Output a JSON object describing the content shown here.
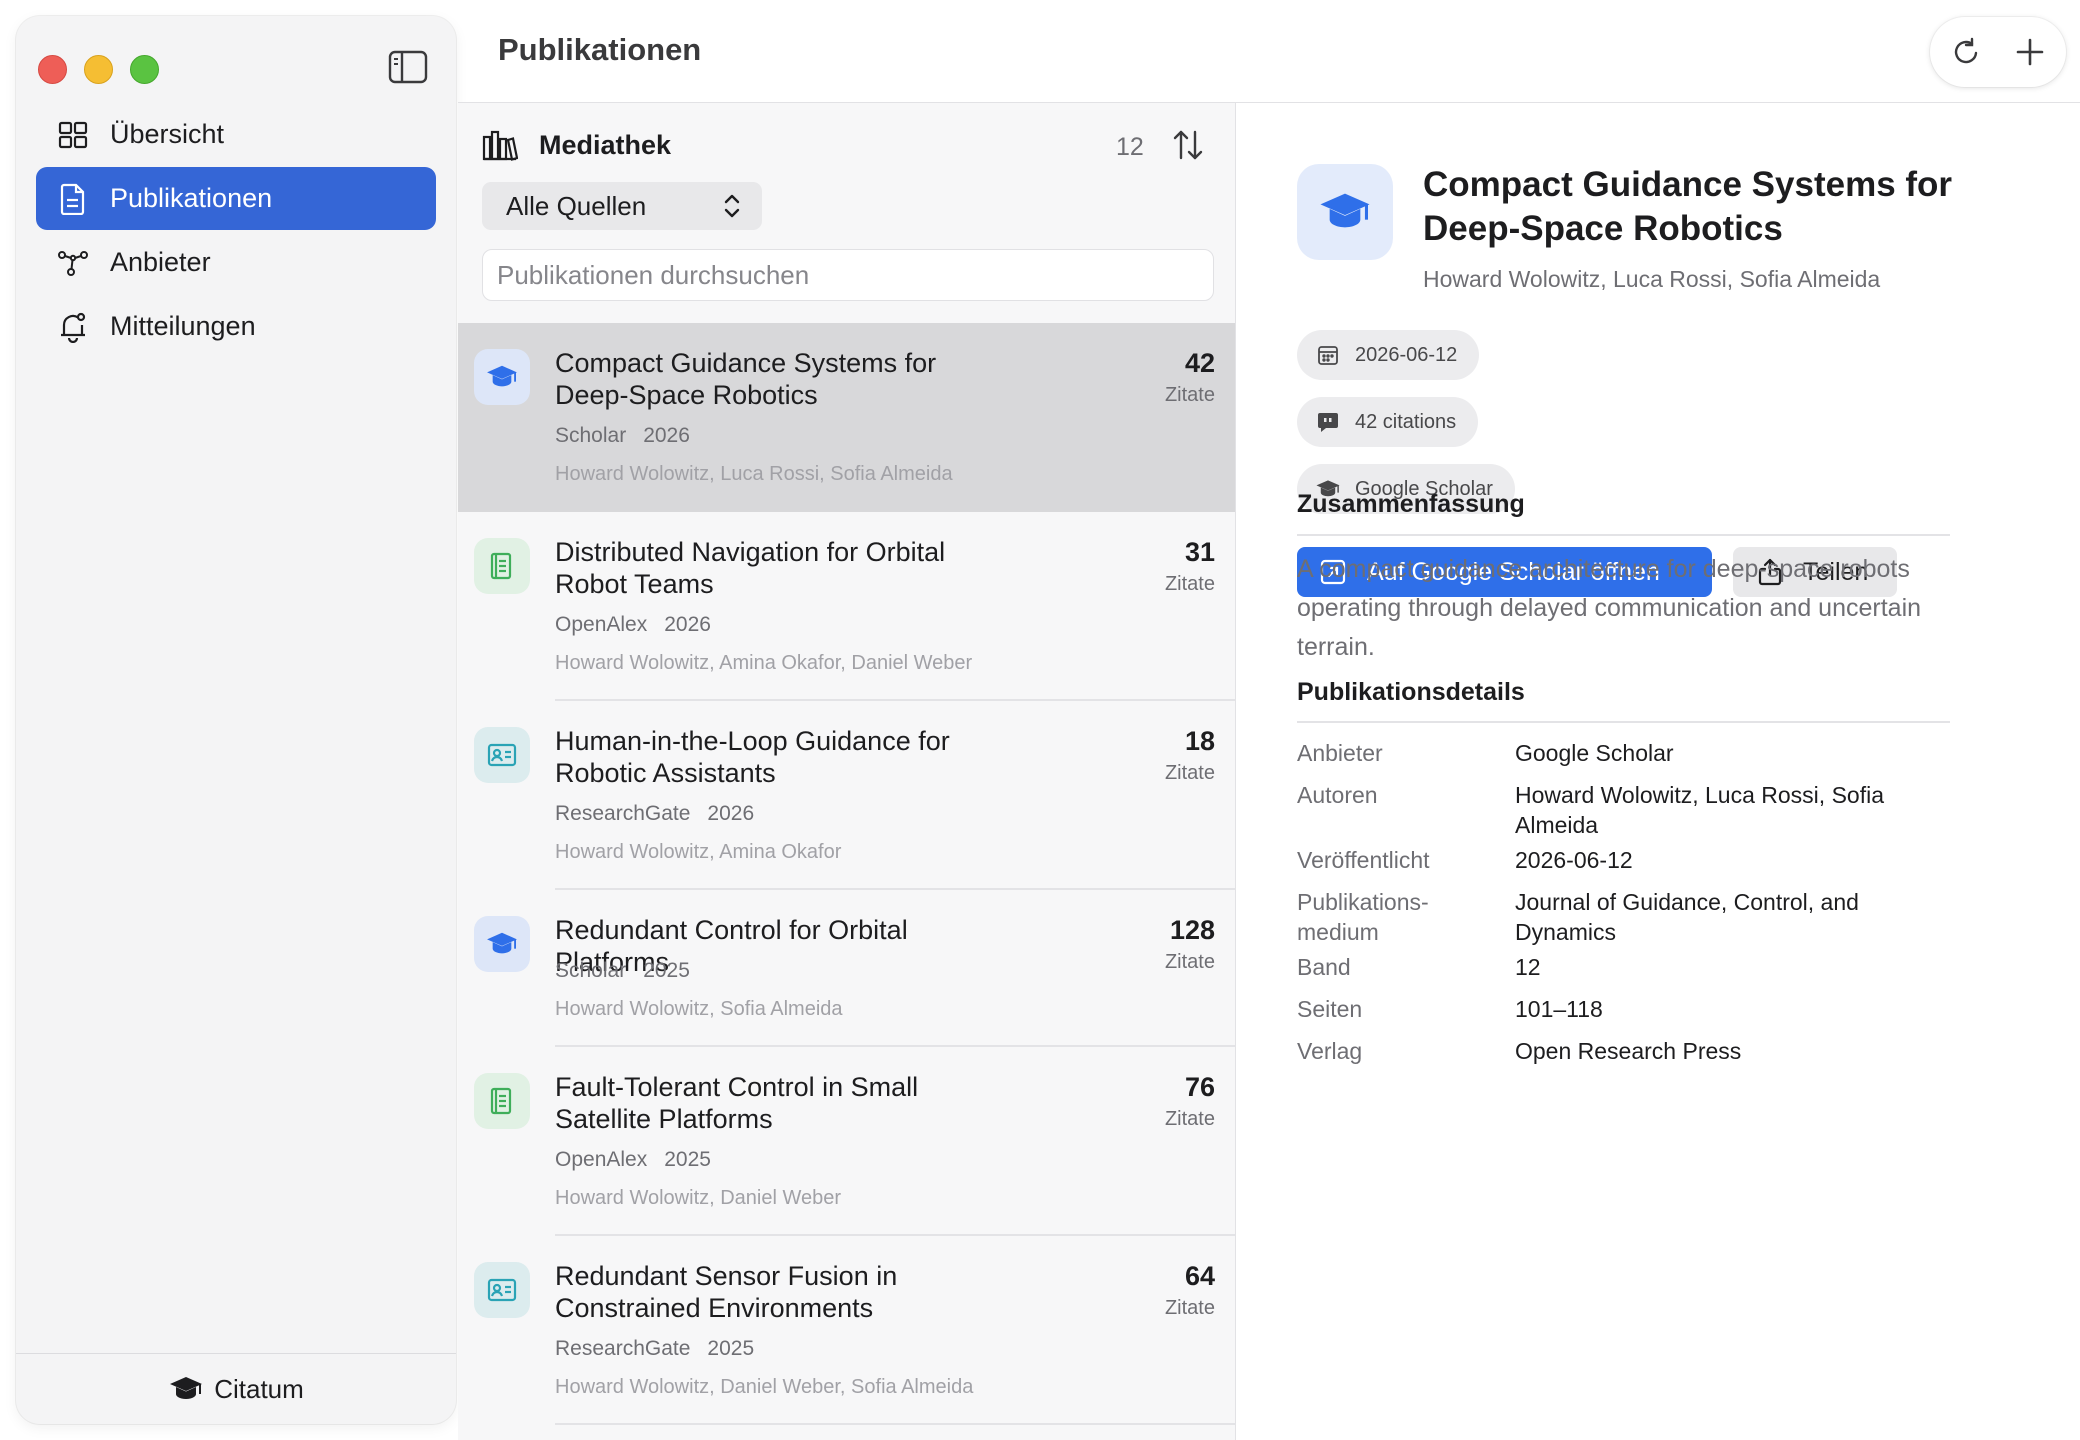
{
  "window": {
    "title": "Publikationen"
  },
  "sidebar": {
    "items": [
      {
        "label": "Übersicht",
        "icon": "grid-icon"
      },
      {
        "label": "Publikationen",
        "icon": "document-icon"
      },
      {
        "label": "Anbieter",
        "icon": "network-icon"
      },
      {
        "label": "Mitteilungen",
        "icon": "bell-icon"
      }
    ],
    "active_index": 1,
    "footer": {
      "app_name": "Citatum",
      "icon": "graduation-cap-icon"
    }
  },
  "toolbar": {
    "refresh_icon": "refresh-icon",
    "add_icon": "plus-icon"
  },
  "library": {
    "title": "Mediathek",
    "count": "12",
    "source_filter": "Alle Quellen",
    "search_placeholder": "Publikationen durchsuchen",
    "items": [
      {
        "title": "Compact Guidance Systems for Deep-Space Robotics",
        "source": "Scholar",
        "year": "2026",
        "authors": "Howard Wolowitz, Luca Rossi, Sofia Almeida",
        "citations": "42",
        "citations_label": "Zitate",
        "icon": "graduation-cap-icon",
        "selected": true
      },
      {
        "title": "Distributed Navigation for Orbital Robot Teams",
        "source": "OpenAlex",
        "year": "2026",
        "authors": "Howard Wolowitz, Amina Okafor, Daniel Weber",
        "citations": "31",
        "citations_label": "Zitate",
        "icon": "open-book-icon",
        "selected": false
      },
      {
        "title": "Human-in-the-Loop Guidance for Robotic Assistants",
        "source": "ResearchGate",
        "year": "2026",
        "authors": "Howard Wolowitz, Amina Okafor",
        "citations": "18",
        "citations_label": "Zitate",
        "icon": "id-card-icon",
        "selected": false
      },
      {
        "title": "Redundant Control for Orbital Platforms",
        "source": "Scholar",
        "year": "2025",
        "authors": "Howard Wolowitz, Sofia Almeida",
        "citations": "128",
        "citations_label": "Zitate",
        "icon": "graduation-cap-icon",
        "selected": false
      },
      {
        "title": "Fault-Tolerant Control in Small Satellite Platforms",
        "source": "OpenAlex",
        "year": "2025",
        "authors": "Howard Wolowitz, Daniel Weber",
        "citations": "76",
        "citations_label": "Zitate",
        "icon": "open-book-icon",
        "selected": false
      },
      {
        "title": "Redundant Sensor Fusion in Constrained Environments",
        "source": "ResearchGate",
        "year": "2025",
        "authors": "Howard Wolowitz, Daniel Weber, Sofia Almeida",
        "citations": "64",
        "citations_label": "Zitate",
        "icon": "id-card-icon",
        "selected": false
      }
    ]
  },
  "detail": {
    "title": "Compact Guidance Systems for Deep-Space Robotics",
    "authors": "Howard Wolowitz, Luca Rossi, Sofia Almeida",
    "chips": {
      "date": "2026-06-12",
      "citations": "42 citations",
      "provider": "Google Scholar"
    },
    "open_button": "Auf Google Scholar öffnen",
    "share_button": "Teilen",
    "summary_heading": "Zusammenfassung",
    "summary": "A compact guidance architecture for deep-space robots operating through delayed communication and uncertain terrain.",
    "details_heading": "Publikationsdetails",
    "fields": [
      {
        "label": "Anbieter",
        "value": "Google Scholar"
      },
      {
        "label": "Autoren",
        "value": "Howard Wolowitz, Luca Rossi, Sofia Almeida"
      },
      {
        "label": "Veröffentlicht",
        "value": "2026-06-12"
      },
      {
        "label": "Publikations-medium",
        "value": "Journal of Guidance, Control, and Dynamics"
      },
      {
        "label": "Band",
        "value": "12"
      },
      {
        "label": "Seiten",
        "value": "101–118"
      },
      {
        "label": "Verlag",
        "value": "Open Research Press"
      }
    ]
  },
  "colors": {
    "accent": "#3566d6",
    "button_primary": "#2f6fe9",
    "selected_row": "#d8d8da",
    "scholar_icon": "#2f6fe9",
    "openalex_icon": "#3fae5a",
    "researchgate_icon": "#2aa3b5"
  }
}
